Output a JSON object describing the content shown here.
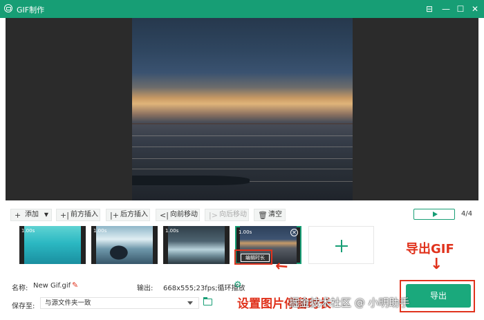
{
  "window": {
    "title": "GIF制作"
  },
  "toolbar": {
    "add": "添加",
    "insert_before": "前方插入",
    "insert_after": "后方插入",
    "move_forward": "向前移动",
    "move_backward": "向后移动",
    "clear": "清空"
  },
  "player": {
    "page_count": "4/4"
  },
  "frames": [
    {
      "duration": "1.00s"
    },
    {
      "duration": "1.00s"
    },
    {
      "duration": "1.00s"
    },
    {
      "duration": "1.00s",
      "edit_label": "编辑时长"
    }
  ],
  "settings": {
    "name_label": "名称:",
    "name_value": "New Gif.gif",
    "output_label": "输出:",
    "output_value": "668x555;23fps;循环播放",
    "save_label": "保存至:",
    "save_value": "与源文件夹一致"
  },
  "export_label": "导出",
  "annotations": {
    "export_gif": "导出GIF",
    "set_duration": "设置图片停留时长",
    "watermark": "掘金技术社区 @ 小明助手"
  },
  "icons": [
    "app-logo-icon",
    "minimize-icon",
    "maximize-icon",
    "close-icon",
    "plus-icon",
    "dropdown-caret-icon",
    "insert-before-icon",
    "insert-after-icon",
    "move-forward-icon",
    "move-backward-icon",
    "trash-icon",
    "play-icon",
    "edit-pencil-icon",
    "settings-gear-icon",
    "folder-icon",
    "add-frame-icon",
    "arrow-icon"
  ],
  "colors": {
    "brand": "#179e75",
    "annotation": "#e0321c"
  }
}
